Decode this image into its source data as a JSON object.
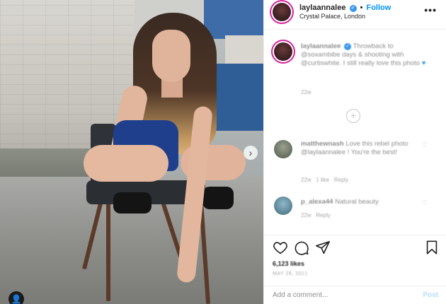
{
  "post": {
    "username": "laylaannalee",
    "follow_label": "Follow",
    "separator": "•",
    "location": "Crystal Palace, London",
    "more_label": "•••",
    "next_label": "›",
    "tag_label": "👤"
  },
  "comments": [
    {
      "username": "laylaannalee",
      "text": "Throwback to @soxambibe days & shooting with @curtiswhite. I still really love this photo",
      "time": "22w",
      "reply": "",
      "likes": ""
    },
    {
      "username": "matthewnash",
      "text": "Love this rebel photo @laylaannalee ! You're the best!",
      "time": "22w",
      "likes": "1 like",
      "reply": "Reply"
    },
    {
      "username": "p_alexa44",
      "text": "Natural beauty",
      "time": "22w",
      "likes": "",
      "reply": "Reply"
    }
  ],
  "load_more_label": "+",
  "likes_count": "6,123 likes",
  "date": "MAY 28, 2021",
  "add_comment": {
    "placeholder": "Add a comment...",
    "post_label": "Post"
  },
  "icons": [
    "heart-icon",
    "comment-icon",
    "share-icon",
    "bookmark-icon"
  ],
  "colors": {
    "follow": "#0095f6",
    "verified": "#3897f0",
    "post_disabled": "#b2dffc"
  }
}
